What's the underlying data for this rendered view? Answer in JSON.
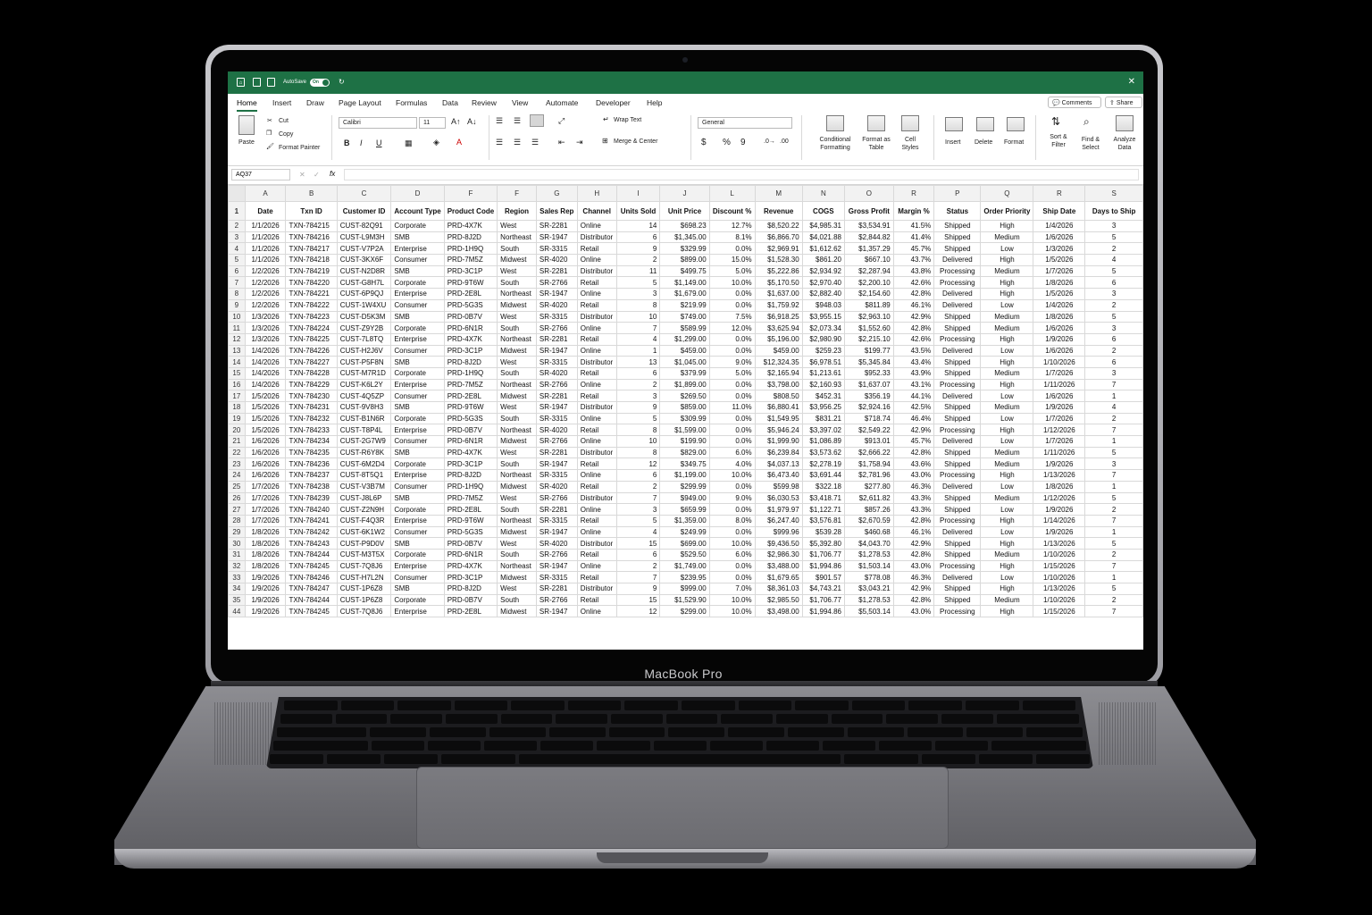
{
  "device": {
    "brand_label": "MacBook Pro"
  },
  "titlebar": {
    "autosave_label": "AutoSave",
    "autosave_state": "On",
    "color": "#1e7145"
  },
  "menu": {
    "tabs": [
      "Home",
      "Insert",
      "Draw",
      "Page Layout",
      "Formulas",
      "Data",
      "Review",
      "View",
      "Automate",
      "Developer",
      "Help"
    ],
    "comments_label": "Comments",
    "share_label": "Share"
  },
  "ribbon": {
    "paste": "Paste",
    "cut": "Cut",
    "copy": "Copy",
    "format_painter": "Format Painter",
    "font": "Calibri",
    "font_size": "11",
    "wrap_text": "Wrap Text",
    "merge_center": "Merge & Center",
    "number_format": "General",
    "conditional_formatting": "Conditional Formatting",
    "format_as_table": "Format as Table",
    "cell_styles": "Cell Styles",
    "insert": "Insert",
    "delete": "Delete",
    "format": "Format",
    "sort_filter": "Sort & Filter",
    "find_select": "Find & Select",
    "analyze": "Analyze Data"
  },
  "formula_bar": {
    "name_box": "AQ37",
    "fx": "fx"
  },
  "sheet": {
    "columns": [
      "A",
      "B",
      "C",
      "D",
      "F",
      "F",
      "G",
      "H",
      "I",
      "J",
      "L",
      "M",
      "N",
      "O",
      "R",
      "P",
      "Q",
      "R",
      "S"
    ],
    "headers": [
      "Date",
      "Txn ID",
      "Customer ID",
      "Account Type",
      "Product Code",
      "Region",
      "Sales Rep",
      "Channel",
      "Units Sold",
      "Unit Price",
      "Discount %",
      "Revenue",
      "COGS",
      "Gross Profit",
      "Margin %",
      "Status",
      "Order Priority",
      "Ship Date",
      "Days to Ship"
    ],
    "rows": [
      [
        "2",
        "1/1/2026",
        "TXN-784215",
        "CUST-82Q91",
        "Corporate",
        "PRD-4X7K",
        "West",
        "SR-2281",
        "Online",
        "14",
        "$698.23",
        "12.7%",
        "$8,520.22",
        "$4,985.31",
        "$3,534.91",
        "41.5%",
        "Shipped",
        "High",
        "1/4/2026",
        "3"
      ],
      [
        "3",
        "1/1/2026",
        "TXN-784216",
        "CUST-L9M3H",
        "SMB",
        "PRD-8J2D",
        "Northeast",
        "SR-1947",
        "Distributor",
        "6",
        "$1,345.00",
        "8.1%",
        "$6,866.70",
        "$4,021.88",
        "$2,844.82",
        "41.4%",
        "Shipped",
        "Medium",
        "1/6/2026",
        "5"
      ],
      [
        "4",
        "1/1/2026",
        "TXN-784217",
        "CUST-V7P2A",
        "Enterprise",
        "PRD-1H9Q",
        "South",
        "SR-3315",
        "Retail",
        "9",
        "$329.99",
        "0.0%",
        "$2,969.91",
        "$1,612.62",
        "$1,357.29",
        "45.7%",
        "Shipped",
        "Low",
        "1/3/2026",
        "2"
      ],
      [
        "5",
        "1/1/2026",
        "TXN-784218",
        "CUST-3KX6F",
        "Consumer",
        "PRD-7M5Z",
        "Midwest",
        "SR-4020",
        "Online",
        "2",
        "$899.00",
        "15.0%",
        "$1,528.30",
        "$861.20",
        "$667.10",
        "43.7%",
        "Delivered",
        "High",
        "1/5/2026",
        "4"
      ],
      [
        "6",
        "1/2/2026",
        "TXN-784219",
        "CUST-N2D8R",
        "SMB",
        "PRD-3C1P",
        "West",
        "SR-2281",
        "Distributor",
        "11",
        "$499.75",
        "5.0%",
        "$5,222.86",
        "$2,934.92",
        "$2,287.94",
        "43.8%",
        "Processing",
        "Medium",
        "1/7/2026",
        "5"
      ],
      [
        "7",
        "1/2/2026",
        "TXN-784220",
        "CUST-G8H7L",
        "Corporate",
        "PRD-9T6W",
        "South",
        "SR-2766",
        "Retail",
        "5",
        "$1,149.00",
        "10.0%",
        "$5,170.50",
        "$2,970.40",
        "$2,200.10",
        "42.6%",
        "Processing",
        "High",
        "1/8/2026",
        "6"
      ],
      [
        "8",
        "1/2/2026",
        "TXN-784221",
        "CUST-6P9QJ",
        "Enterprise",
        "PRD-2E8L",
        "Northeast",
        "SR-1947",
        "Online",
        "3",
        "$1,679.00",
        "0.0%",
        "$1,637.00",
        "$2,882.40",
        "$2,154.60",
        "42.8%",
        "Delivered",
        "High",
        "1/5/2026",
        "3"
      ],
      [
        "9",
        "1/2/2026",
        "TXN-784222",
        "CUST-1W4XU",
        "Consumer",
        "PRD-5G3S",
        "Midwest",
        "SR-4020",
        "Retail",
        "8",
        "$219.99",
        "0.0%",
        "$1,759.92",
        "$948.03",
        "$811.89",
        "46.1%",
        "Delivered",
        "Low",
        "1/4/2026",
        "2"
      ],
      [
        "10",
        "1/3/2026",
        "TXN-784223",
        "CUST-D5K3M",
        "SMB",
        "PRD-0B7V",
        "West",
        "SR-3315",
        "Distributor",
        "10",
        "$749.00",
        "7.5%",
        "$6,918.25",
        "$3,955.15",
        "$2,963.10",
        "42.9%",
        "Shipped",
        "Medium",
        "1/8/2026",
        "5"
      ],
      [
        "11",
        "1/3/2026",
        "TXN-784224",
        "CUST-Z9Y2B",
        "Corporate",
        "PRD-6N1R",
        "South",
        "SR-2766",
        "Online",
        "7",
        "$589.99",
        "12.0%",
        "$3,625.94",
        "$2,073.34",
        "$1,552.60",
        "42.8%",
        "Shipped",
        "Medium",
        "1/6/2026",
        "3"
      ],
      [
        "12",
        "1/3/2026",
        "TXN-784225",
        "CUST-7L8TQ",
        "Enterprise",
        "PRD-4X7K",
        "Northeast",
        "SR-2281",
        "Retail",
        "4",
        "$1,299.00",
        "0.0%",
        "$5,196.00",
        "$2,980.90",
        "$2,215.10",
        "42.6%",
        "Processing",
        "High",
        "1/9/2026",
        "6"
      ],
      [
        "13",
        "1/4/2026",
        "TXN-784226",
        "CUST-H2J6V",
        "Consumer",
        "PRD-3C1P",
        "Midwest",
        "SR-1947",
        "Online",
        "1",
        "$459.00",
        "0.0%",
        "$459.00",
        "$259.23",
        "$199.77",
        "43.5%",
        "Delivered",
        "Low",
        "1/6/2026",
        "2"
      ],
      [
        "14",
        "1/4/2026",
        "TXN-784227",
        "CUST-P5F8N",
        "SMB",
        "PRD-8J2D",
        "West",
        "SR-3315",
        "Distributor",
        "13",
        "$1,045.00",
        "9.0%",
        "$12,324.35",
        "$6,978.51",
        "$5,345.84",
        "43.4%",
        "Shipped",
        "High",
        "1/10/2026",
        "6"
      ],
      [
        "15",
        "1/4/2026",
        "TXN-784228",
        "CUST-M7R1D",
        "Corporate",
        "PRD-1H9Q",
        "South",
        "SR-4020",
        "Retail",
        "6",
        "$379.99",
        "5.0%",
        "$2,165.94",
        "$1,213.61",
        "$952.33",
        "43.9%",
        "Shipped",
        "Medium",
        "1/7/2026",
        "3"
      ],
      [
        "16",
        "1/4/2026",
        "TXN-784229",
        "CUST-K6L2Y",
        "Enterprise",
        "PRD-7M5Z",
        "Northeast",
        "SR-2766",
        "Online",
        "2",
        "$1,899.00",
        "0.0%",
        "$3,798.00",
        "$2,160.93",
        "$1,637.07",
        "43.1%",
        "Processing",
        "High",
        "1/11/2026",
        "7"
      ],
      [
        "17",
        "1/5/2026",
        "TXN-784230",
        "CUST-4Q5ZP",
        "Consumer",
        "PRD-2E8L",
        "Midwest",
        "SR-2281",
        "Retail",
        "3",
        "$269.50",
        "0.0%",
        "$808.50",
        "$452.31",
        "$356.19",
        "44.1%",
        "Delivered",
        "Low",
        "1/6/2026",
        "1"
      ],
      [
        "18",
        "1/5/2026",
        "TXN-784231",
        "CUST-9V8H3",
        "SMB",
        "PRD-9T6W",
        "West",
        "SR-1947",
        "Distributor",
        "9",
        "$859.00",
        "11.0%",
        "$6,880.41",
        "$3,956.25",
        "$2,924.16",
        "42.5%",
        "Shipped",
        "Medium",
        "1/9/2026",
        "4"
      ],
      [
        "19",
        "1/5/2026",
        "TXN-784232",
        "CUST-B1N6R",
        "Corporate",
        "PRD-5G3S",
        "South",
        "SR-3315",
        "Online",
        "5",
        "$309.99",
        "0.0%",
        "$1,549.95",
        "$831.21",
        "$718.74",
        "46.4%",
        "Shipped",
        "Low",
        "1/7/2026",
        "2"
      ],
      [
        "20",
        "1/5/2026",
        "TXN-784233",
        "CUST-T8P4L",
        "Enterprise",
        "PRD-0B7V",
        "Northeast",
        "SR-4020",
        "Retail",
        "8",
        "$1,599.00",
        "0.0%",
        "$5,946.24",
        "$3,397.02",
        "$2,549.22",
        "42.9%",
        "Processing",
        "High",
        "1/12/2026",
        "7"
      ],
      [
        "21",
        "1/6/2026",
        "TXN-784234",
        "CUST-2G7W9",
        "Consumer",
        "PRD-6N1R",
        "Midwest",
        "SR-2766",
        "Online",
        "10",
        "$199.90",
        "0.0%",
        "$1,999.90",
        "$1,086.89",
        "$913.01",
        "45.7%",
        "Delivered",
        "Low",
        "1/7/2026",
        "1"
      ],
      [
        "22",
        "1/6/2026",
        "TXN-784235",
        "CUST-R6Y8K",
        "SMB",
        "PRD-4X7K",
        "West",
        "SR-2281",
        "Distributor",
        "8",
        "$829.00",
        "6.0%",
        "$6,239.84",
        "$3,573.62",
        "$2,666.22",
        "42.8%",
        "Shipped",
        "Medium",
        "1/11/2026",
        "5"
      ],
      [
        "23",
        "1/6/2026",
        "TXN-784236",
        "CUST-6M2D4",
        "Corporate",
        "PRD-3C1P",
        "South",
        "SR-1947",
        "Retail",
        "12",
        "$349.75",
        "4.0%",
        "$4,037.13",
        "$2,278.19",
        "$1,758.94",
        "43.6%",
        "Shipped",
        "Medium",
        "1/9/2026",
        "3"
      ],
      [
        "24",
        "1/6/2026",
        "TXN-784237",
        "CUST-8T5Q1",
        "Enterprise",
        "PRD-8J2D",
        "Northeast",
        "SR-3315",
        "Online",
        "6",
        "$1,199.00",
        "10.0%",
        "$6,473.40",
        "$3,691.44",
        "$2,781.96",
        "43.0%",
        "Processing",
        "High",
        "1/13/2026",
        "7"
      ],
      [
        "25",
        "1/7/2026",
        "TXN-784238",
        "CUST-V3B7M",
        "Consumer",
        "PRD-1H9Q",
        "Midwest",
        "SR-4020",
        "Retail",
        "2",
        "$299.99",
        "0.0%",
        "$599.98",
        "$322.18",
        "$277.80",
        "46.3%",
        "Delivered",
        "Low",
        "1/8/2026",
        "1"
      ],
      [
        "26",
        "1/7/2026",
        "TXN-784239",
        "CUST-J8L6P",
        "SMB",
        "PRD-7M5Z",
        "West",
        "SR-2766",
        "Distributor",
        "7",
        "$949.00",
        "9.0%",
        "$6,030.53",
        "$3,418.71",
        "$2,611.82",
        "43.3%",
        "Shipped",
        "Medium",
        "1/12/2026",
        "5"
      ],
      [
        "27",
        "1/7/2026",
        "TXN-784240",
        "CUST-Z2N9H",
        "Corporate",
        "PRD-2E8L",
        "South",
        "SR-2281",
        "Online",
        "3",
        "$659.99",
        "0.0%",
        "$1,979.97",
        "$1,122.71",
        "$857.26",
        "43.3%",
        "Shipped",
        "Low",
        "1/9/2026",
        "2"
      ],
      [
        "28",
        "1/7/2026",
        "TXN-784241",
        "CUST-F4Q3R",
        "Enterprise",
        "PRD-9T6W",
        "Northeast",
        "SR-3315",
        "Retail",
        "5",
        "$1,359.00",
        "8.0%",
        "$6,247.40",
        "$3,576.81",
        "$2,670.59",
        "42.8%",
        "Processing",
        "High",
        "1/14/2026",
        "7"
      ],
      [
        "29",
        "1/8/2026",
        "TXN-784242",
        "CUST-6K1W2",
        "Consumer",
        "PRD-5G3S",
        "Midwest",
        "SR-1947",
        "Online",
        "4",
        "$249.99",
        "0.0%",
        "$999.96",
        "$539.28",
        "$460.68",
        "46.1%",
        "Delivered",
        "Low",
        "1/9/2026",
        "1"
      ],
      [
        "30",
        "1/8/2026",
        "TXN-784243",
        "CUST-P9D0V",
        "SMB",
        "PRD-0B7V",
        "West",
        "SR-4020",
        "Distributor",
        "15",
        "$699.00",
        "10.0%",
        "$9,436.50",
        "$5,392.80",
        "$4,043.70",
        "42.9%",
        "Shipped",
        "High",
        "1/13/2026",
        "5"
      ],
      [
        "31",
        "1/8/2026",
        "TXN-784244",
        "CUST-M3T5X",
        "Corporate",
        "PRD-6N1R",
        "South",
        "SR-2766",
        "Retail",
        "6",
        "$529.50",
        "6.0%",
        "$2,986.30",
        "$1,706.77",
        "$1,278.53",
        "42.8%",
        "Shipped",
        "Medium",
        "1/10/2026",
        "2"
      ],
      [
        "32",
        "1/8/2026",
        "TXN-784245",
        "CUST-7Q8J6",
        "Enterprise",
        "PRD-4X7K",
        "Northeast",
        "SR-1947",
        "Online",
        "2",
        "$1,749.00",
        "0.0%",
        "$3,488.00",
        "$1,994.86",
        "$1,503.14",
        "43.0%",
        "Processing",
        "High",
        "1/15/2026",
        "7"
      ],
      [
        "33",
        "1/9/2026",
        "TXN-784246",
        "CUST-H7L2N",
        "Consumer",
        "PRD-3C1P",
        "Midwest",
        "SR-3315",
        "Retail",
        "7",
        "$239.95",
        "0.0%",
        "$1,679.65",
        "$901.57",
        "$778.08",
        "46.3%",
        "Delivered",
        "Low",
        "1/10/2026",
        "1"
      ],
      [
        "34",
        "1/9/2026",
        "TXN-784247",
        "CUST-1P6Z8",
        "SMB",
        "PRD-8J2D",
        "West",
        "SR-2281",
        "Distributor",
        "9",
        "$999.00",
        "7.0%",
        "$8,361.03",
        "$4,743.21",
        "$3,043.21",
        "42.9%",
        "Shipped",
        "High",
        "1/13/2026",
        "5"
      ],
      [
        "35",
        "1/9/2026",
        "TXN-784244",
        "CUST-1P6Z8",
        "Corporate",
        "PRD-0B7V",
        "South",
        "SR-2766",
        "Retail",
        "15",
        "$1,529.90",
        "10.0%",
        "$2,985.50",
        "$1,706.77",
        "$1,278.53",
        "42.8%",
        "Shipped",
        "Medium",
        "1/10/2026",
        "2"
      ],
      [
        "44",
        "1/9/2026",
        "TXN-784245",
        "CUST-7Q8J6",
        "Enterprise",
        "PRD-2E8L",
        "Midwest",
        "SR-1947",
        "Online",
        "12",
        "$299.00",
        "10.0%",
        "$3,498.00",
        "$1,994.86",
        "$5,503.14",
        "43.0%",
        "Processing",
        "High",
        "1/15/2026",
        "7"
      ]
    ]
  }
}
